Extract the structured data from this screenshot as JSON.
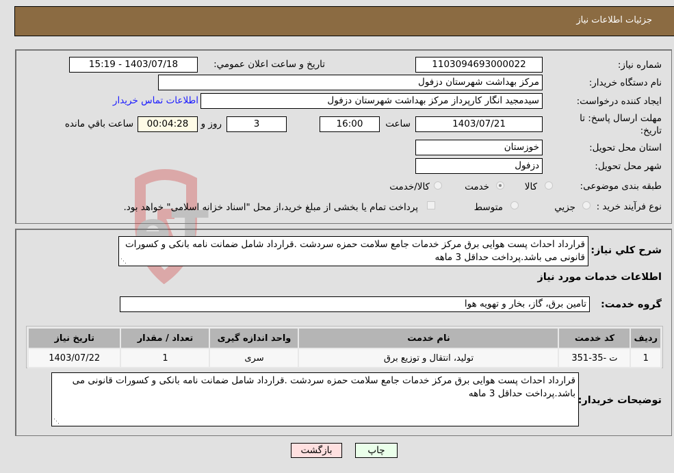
{
  "header": {
    "title": "جزئیات اطلاعات نیاز"
  },
  "form": {
    "need_number": {
      "label": "شماره نیاز:",
      "value": "1103094693000022"
    },
    "announce_datetime": {
      "label": "تاريخ و ساعت اعلان عمومي:",
      "value": "1403/07/18 - 15:19"
    },
    "buyer_org": {
      "label": "نام دستگاه خریدار:",
      "value": "مرکز بهداشت شهرستان دزفول"
    },
    "requester": {
      "label": "ایجاد کننده درخواست:",
      "value": "سیدمجید انگار کارپرداز مرکز بهداشت شهرستان دزفول"
    },
    "buyer_contact_link": "اطلاعات تماس خریدار",
    "deadline": {
      "label": "مهلت ارسال پاسخ: تا تاریخ:",
      "date": "1403/07/21",
      "time_label": "ساعت",
      "time": "16:00",
      "days": "3",
      "days_label": "روز و",
      "remaining": "00:04:28",
      "remaining_label": "ساعت باقي مانده"
    },
    "province": {
      "label": "استان محل تحویل:",
      "value": "خوزستان"
    },
    "city": {
      "label": "شهر محل تحویل:",
      "value": "دزفول"
    },
    "category": {
      "label": "طبقه بندی موضوعی:",
      "options": [
        "کالا",
        "خدمت",
        "کالا/خدمت"
      ],
      "selected": "خدمت"
    },
    "purchase_type": {
      "label": "نوع فرآیند خرید :",
      "options": [
        "جزیي",
        "متوسط"
      ],
      "checkbox_label": "پرداخت تمام یا بخشی از مبلغ خرید،از محل \"اسناد خزانه اسلامی\" خواهد بود."
    }
  },
  "details": {
    "summary_label": "شرح کلي نياز:",
    "summary": "قرارداد احداث پست هوایی برق مرکز خدمات جامع سلامت حمزه سردشت .قرارداد شامل ضمانت نامه بانکی و کسورات قانونی می باشد.پرداخت حداقل 3 ماهه",
    "services_heading": "اطلاعات خدمات مورد نیاز",
    "service_group_label": "گروه خدمت:",
    "service_group": "تامین برق، گاز، بخار و تهویه هوا",
    "table": {
      "headers": [
        "ردیف",
        "کد خدمت",
        "نام خدمت",
        "واحد اندازه گیری",
        "تعداد / مقدار",
        "تاریخ نیاز"
      ],
      "rows": [
        [
          "1",
          "ت -35-351",
          "تولید، انتقال و توزیع برق",
          "سری",
          "1",
          "1403/07/22"
        ]
      ]
    },
    "buyer_notes_label": "توضیحات خریدار:",
    "buyer_notes": "قرارداد احداث پست هوایی برق مرکز خدمات جامع سلامت حمزه سردشت .قرارداد شامل ضمانت نامه بانکی و کسورات قانونی می باشد.پرداخت حداقل 3 ماهه"
  },
  "buttons": {
    "print": "چاپ",
    "back": "بازگشت"
  },
  "watermark": "AriaTender.neT",
  "colors": {
    "header_bg": "#8b6b42",
    "print_bg": "#eaffea",
    "back_bg": "#ffe0e0",
    "link": "#1a1aff",
    "countdown_bg": "#fffbe6"
  }
}
